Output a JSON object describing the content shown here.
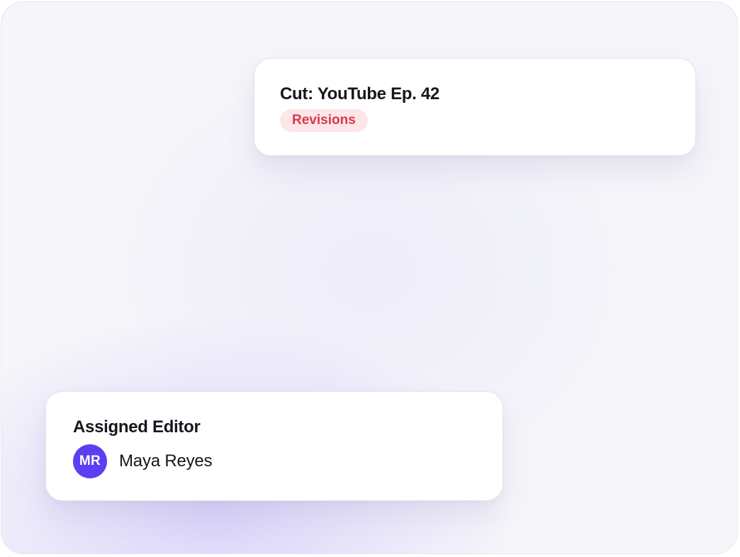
{
  "task_card": {
    "title": "Cut: YouTube Ep. 42",
    "status": "Revisions",
    "status_color": "#d63a4b",
    "status_bg": "#fde6e8"
  },
  "editor_card": {
    "heading": "Assigned Editor",
    "avatar_initials": "MR",
    "avatar_color": "#5b3ff2",
    "name": "Maya Reyes"
  }
}
